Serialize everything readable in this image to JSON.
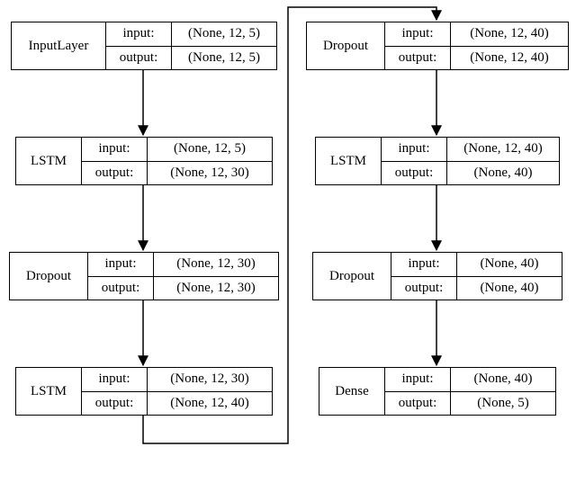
{
  "labels": {
    "input": "input:",
    "output": "output:"
  },
  "layers": [
    {
      "name": "InputLayer",
      "input": "(None, 12, 5)",
      "output": "(None, 12, 5)"
    },
    {
      "name": "LSTM",
      "input": "(None, 12, 5)",
      "output": "(None, 12, 30)"
    },
    {
      "name": "Dropout",
      "input": "(None, 12, 30)",
      "output": "(None, 12, 30)"
    },
    {
      "name": "LSTM",
      "input": "(None, 12, 30)",
      "output": "(None, 12, 40)"
    },
    {
      "name": "Dropout",
      "input": "(None, 12, 40)",
      "output": "(None, 12, 40)"
    },
    {
      "name": "LSTM",
      "input": "(None, 12, 40)",
      "output": "(None, 40)"
    },
    {
      "name": "Dropout",
      "input": "(None, 40)",
      "output": "(None, 40)"
    },
    {
      "name": "Dense",
      "input": "(None, 40)",
      "output": "(None, 5)"
    }
  ]
}
